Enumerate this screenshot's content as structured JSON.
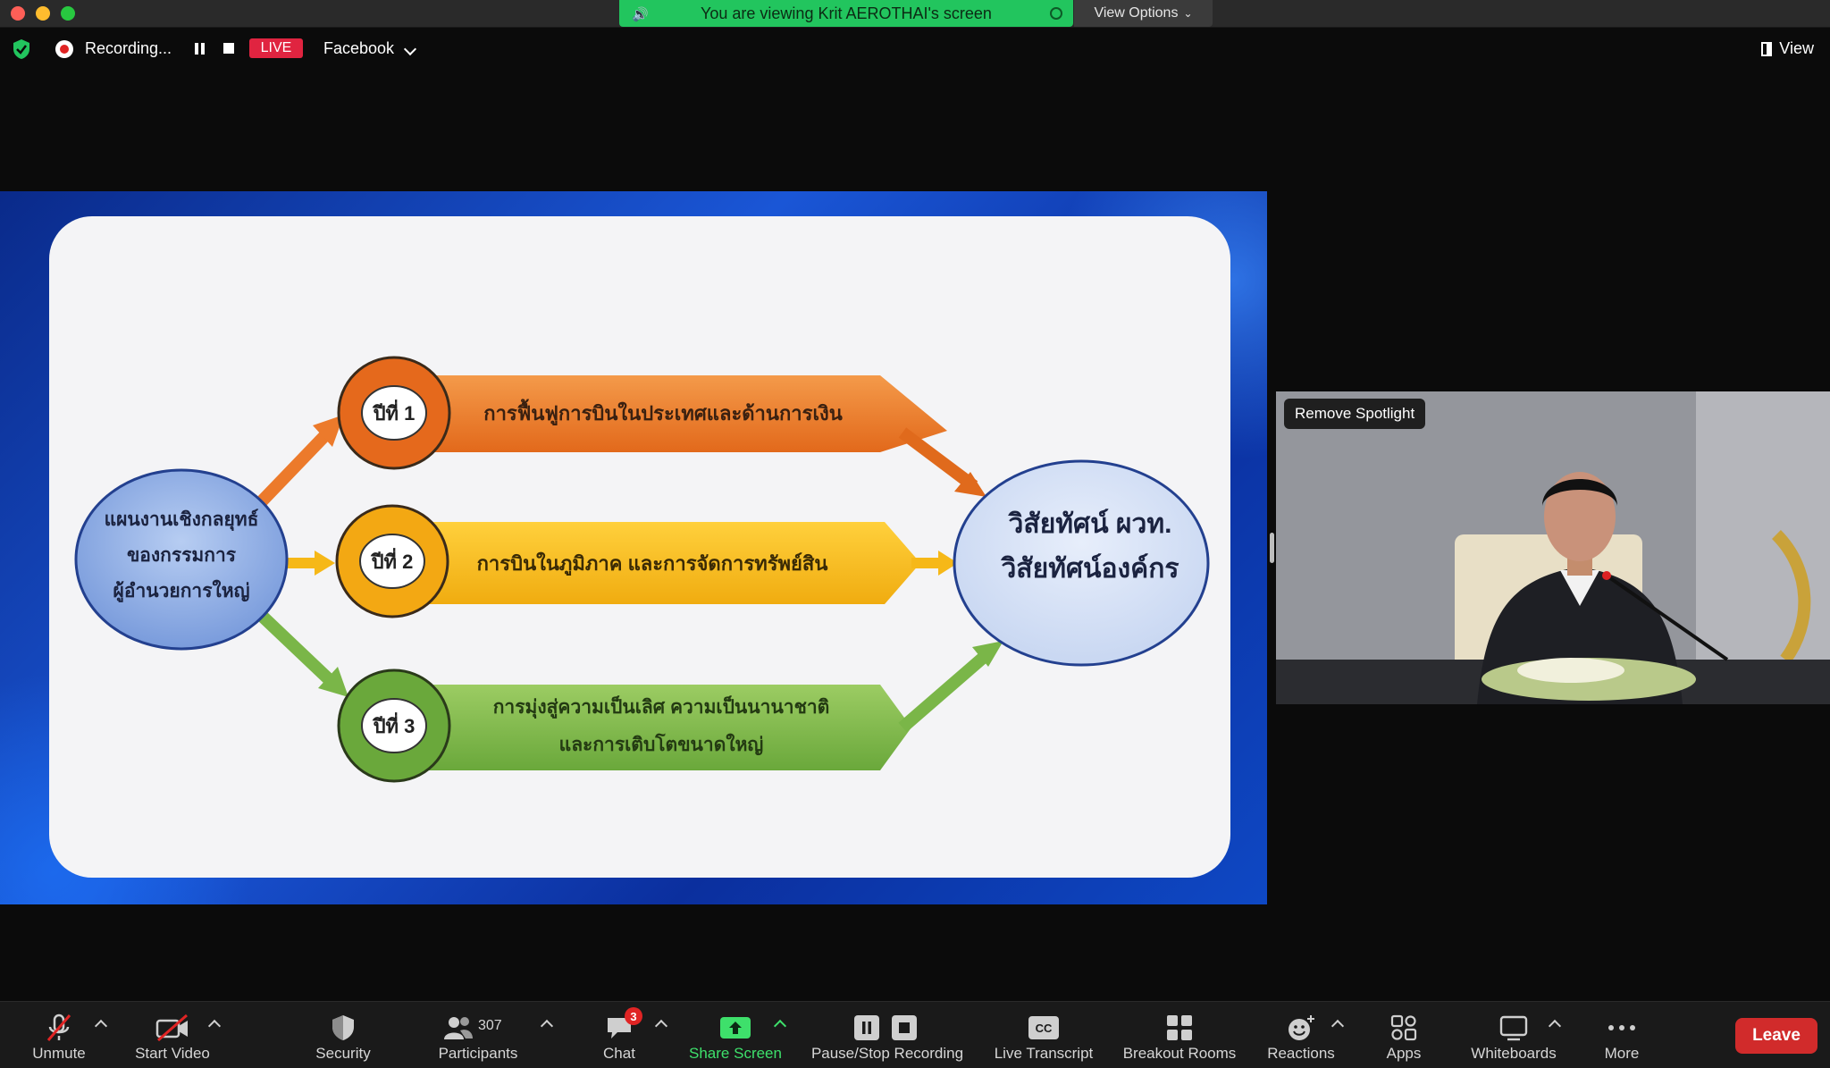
{
  "banner": {
    "viewing_text": "You are viewing Krit AEROTHAI's screen",
    "view_options_label": "View Options"
  },
  "status_bar": {
    "recording_label": "Recording...",
    "live_label": "LIVE",
    "stream_target": "Facebook",
    "view_label": "View"
  },
  "slide": {
    "left_circle_lines": [
      "แผนงานเชิงกลยุทธ์",
      "ของกรรมการ",
      "ผู้อำนวยการใหญ่"
    ],
    "right_circle_lines": [
      "วิสัยทัศน์ ผวท.",
      "วิสัยทัศน์องค์กร"
    ],
    "stages": [
      {
        "year_label": "ปีที่ 1",
        "text_lines": [
          "การฟื้นฟูการบินในประเทศและด้านการเงิน"
        ],
        "color": "#ef7d28"
      },
      {
        "year_label": "ปีที่ 2",
        "text_lines": [
          "การบินในภูมิภาค และการจัดการทรัพย์สิน"
        ],
        "color": "#f6b818"
      },
      {
        "year_label": "ปีที่ 3",
        "text_lines": [
          "การมุ่งสู่ความเป็นเลิศ ความเป็นนานาชาติ",
          "และการเติบโตขนาดใหญ่"
        ],
        "color": "#7ab648"
      }
    ]
  },
  "video": {
    "remove_spotlight_label": "Remove Spotlight"
  },
  "toolbar": {
    "unmute": "Unmute",
    "start_video": "Start Video",
    "security": "Security",
    "participants": "Participants",
    "participants_count": "307",
    "chat": "Chat",
    "chat_badge": "3",
    "share_screen": "Share Screen",
    "pause_stop_recording": "Pause/Stop Recording",
    "live_transcript": "Live Transcript",
    "cc_text": "CC",
    "breakout_rooms": "Breakout Rooms",
    "reactions": "Reactions",
    "apps": "Apps",
    "whiteboards": "Whiteboards",
    "more": "More",
    "leave": "Leave"
  },
  "colors": {
    "share_green": "#3ee06b",
    "banner_green": "#22c55e",
    "leave_red": "#d12b2b",
    "live_red": "#e02440"
  }
}
